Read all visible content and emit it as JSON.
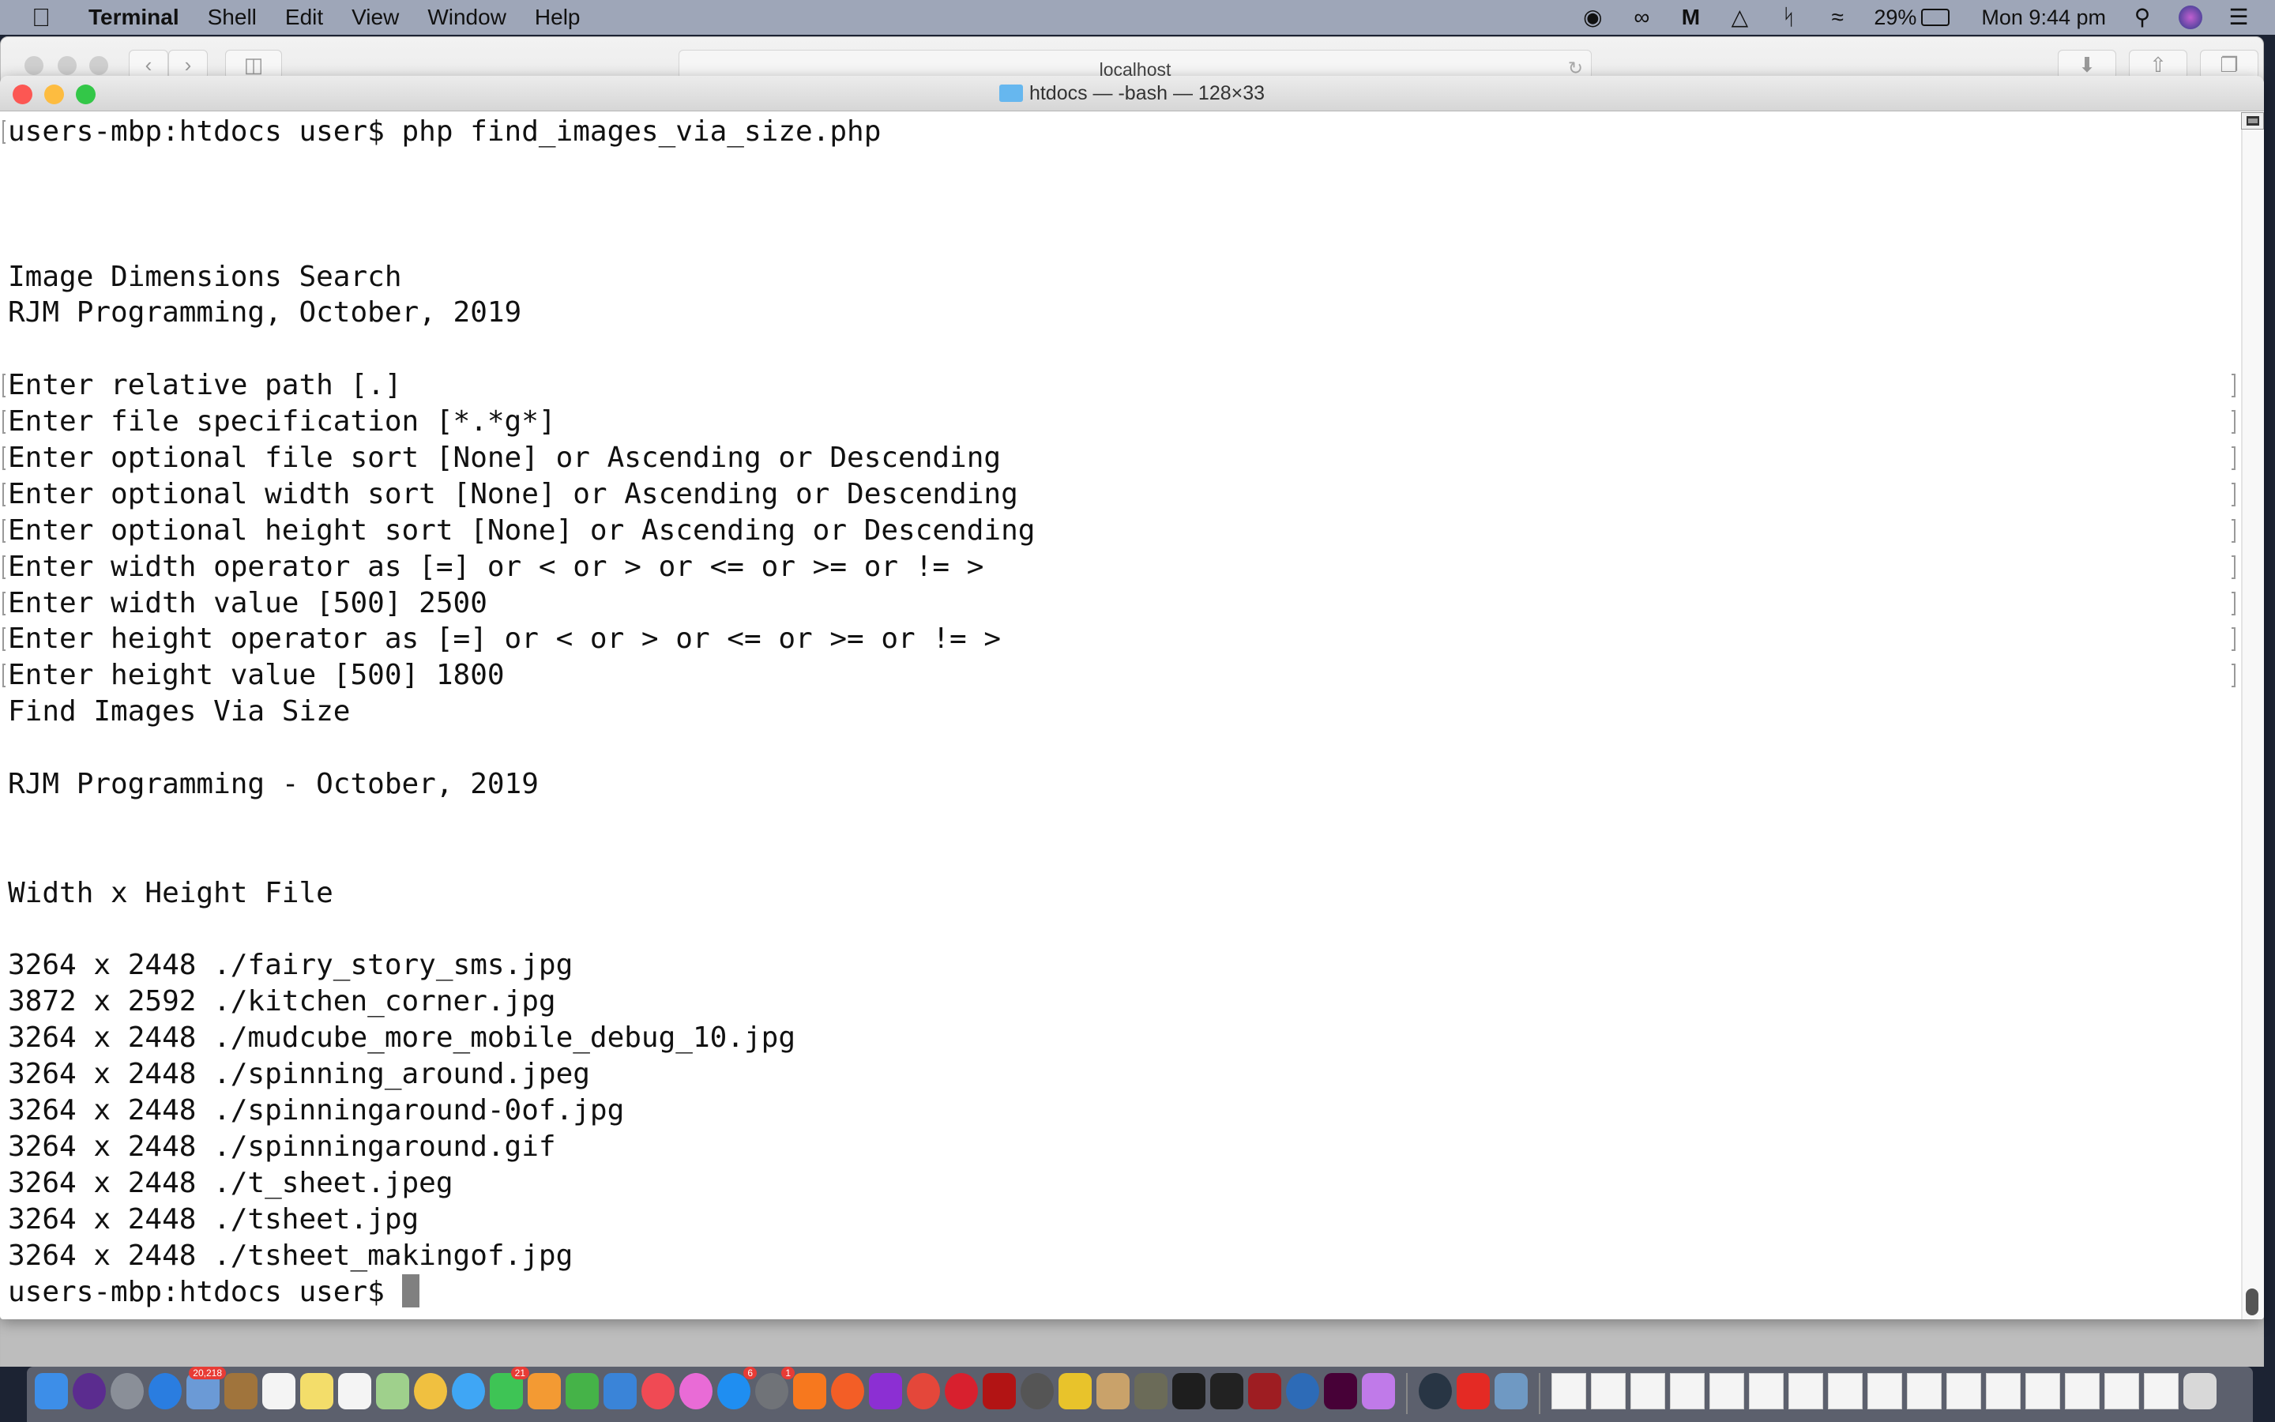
{
  "menubar": {
    "app": "Terminal",
    "items": [
      "Shell",
      "Edit",
      "View",
      "Window",
      "Help"
    ],
    "battery": "29%",
    "clock": "Mon 9:44 pm",
    "status_icons": [
      "avast-icon",
      "creative-cloud-icon",
      "malwarebytes-icon",
      "airplay-icon",
      "bluetooth-icon",
      "wifi-icon"
    ]
  },
  "safari": {
    "address": "localhost"
  },
  "terminal": {
    "title": "htdocs — -bash — 128×33",
    "lines": [
      {
        "t": "users-mbp:htdocs user$ php find_images_via_size.php",
        "m": true
      },
      {
        "t": ""
      },
      {
        "t": ""
      },
      {
        "t": ""
      },
      {
        "t": "Image Dimensions Search"
      },
      {
        "t": "RJM Programming, October, 2019"
      },
      {
        "t": ""
      },
      {
        "t": "Enter relative path [.]",
        "m": true,
        "r": true
      },
      {
        "t": "Enter file specification [*.*g*]",
        "m": true,
        "r": true
      },
      {
        "t": "Enter optional file sort [None] or Ascending or Descending",
        "m": true,
        "r": true
      },
      {
        "t": "Enter optional width sort [None] or Ascending or Descending",
        "m": true,
        "r": true
      },
      {
        "t": "Enter optional height sort [None] or Ascending or Descending",
        "m": true,
        "r": true
      },
      {
        "t": "Enter width operator as [=] or < or > or <= or >= or != >",
        "m": true,
        "r": true
      },
      {
        "t": "Enter width value [500] 2500",
        "m": true,
        "r": true
      },
      {
        "t": "Enter height operator as [=] or < or > or <= or >= or != >",
        "m": true,
        "r": true
      },
      {
        "t": "Enter height value [500] 1800",
        "m": true,
        "r": true
      },
      {
        "t": "Find Images Via Size"
      },
      {
        "t": ""
      },
      {
        "t": "RJM Programming - October, 2019"
      },
      {
        "t": ""
      },
      {
        "t": ""
      },
      {
        "t": "Width x Height File"
      },
      {
        "t": ""
      },
      {
        "t": "3264 x 2448 ./fairy_story_sms.jpg"
      },
      {
        "t": "3872 x 2592 ./kitchen_corner.jpg"
      },
      {
        "t": "3264 x 2448 ./mudcube_more_mobile_debug_10.jpg"
      },
      {
        "t": "3264 x 2448 ./spinning_around.jpeg"
      },
      {
        "t": "3264 x 2448 ./spinningaround-0of.jpg"
      },
      {
        "t": "3264 x 2448 ./spinningaround.gif"
      },
      {
        "t": "3264 x 2448 ./t_sheet.jpeg"
      },
      {
        "t": "3264 x 2448 ./tsheet.jpg"
      },
      {
        "t": "3264 x 2448 ./tsheet_makingof.jpg"
      },
      {
        "t": "users-mbp:htdocs user$ ",
        "cursor": true
      }
    ]
  },
  "dock": {
    "apps": [
      {
        "n": "finder",
        "c": "#3d8ee8"
      },
      {
        "n": "siri",
        "c": "#5b2c8f",
        "r": 1
      },
      {
        "n": "launchpad",
        "c": "#8a8f98",
        "r": 1
      },
      {
        "n": "safari",
        "c": "#2a7de0",
        "r": 1
      },
      {
        "n": "mail",
        "c": "#6b9ad6",
        "b": "20,218"
      },
      {
        "n": "contacts",
        "c": "#a0743c"
      },
      {
        "n": "calendar",
        "c": "#f4f4f4"
      },
      {
        "n": "notes",
        "c": "#f3dd6a"
      },
      {
        "n": "reminders",
        "c": "#f4f4f4"
      },
      {
        "n": "maps",
        "c": "#9fd08c"
      },
      {
        "n": "photos",
        "c": "#f0c040",
        "r": 1
      },
      {
        "n": "messages",
        "c": "#3fa6f5",
        "r": 1
      },
      {
        "n": "facetime",
        "c": "#3ec455",
        "b": "21"
      },
      {
        "n": "pages",
        "c": "#f39a33"
      },
      {
        "n": "numbers",
        "c": "#45b348"
      },
      {
        "n": "keynote",
        "c": "#3a84d8"
      },
      {
        "n": "news",
        "c": "#f04a54",
        "r": 1
      },
      {
        "n": "itunes",
        "c": "#e96bd6",
        "r": 1
      },
      {
        "n": "app-store",
        "c": "#1f8ef1",
        "r": 1,
        "b": "6"
      },
      {
        "n": "system-preferences",
        "c": "#707378",
        "r": 1,
        "b": "1"
      },
      {
        "n": "avast",
        "c": "#f7781e"
      },
      {
        "n": "firefox",
        "c": "#f35e26",
        "r": 1
      },
      {
        "n": "phpstorm",
        "c": "#8c2fd3"
      },
      {
        "n": "chrome",
        "c": "#e4473a",
        "r": 1
      },
      {
        "n": "opera",
        "c": "#d8202e",
        "r": 1
      },
      {
        "n": "filezilla",
        "c": "#b21414"
      },
      {
        "n": "sequel-pro",
        "c": "#555",
        "r": 1
      },
      {
        "n": "cyberduck",
        "c": "#e8c32b"
      },
      {
        "n": "script-editor",
        "c": "#c9a26a"
      },
      {
        "n": "gimp",
        "c": "#6b6b58"
      },
      {
        "n": "terminal",
        "c": "#1e1e1e"
      },
      {
        "n": "inkscape",
        "c": "#222"
      },
      {
        "n": "photo-booth",
        "c": "#9e1d22"
      },
      {
        "n": "r",
        "c": "#2d6bb7",
        "r": 1
      },
      {
        "n": "adobe-xd",
        "c": "#470137"
      },
      {
        "n": "sketch-like",
        "c": "#c07ae9"
      },
      {
        "n": "quicktime",
        "c": "#283544",
        "r": 1
      },
      {
        "n": "creative-cloud",
        "c": "#e42a24"
      },
      {
        "n": "preview",
        "c": "#6f99c3"
      }
    ],
    "docs": 16
  }
}
